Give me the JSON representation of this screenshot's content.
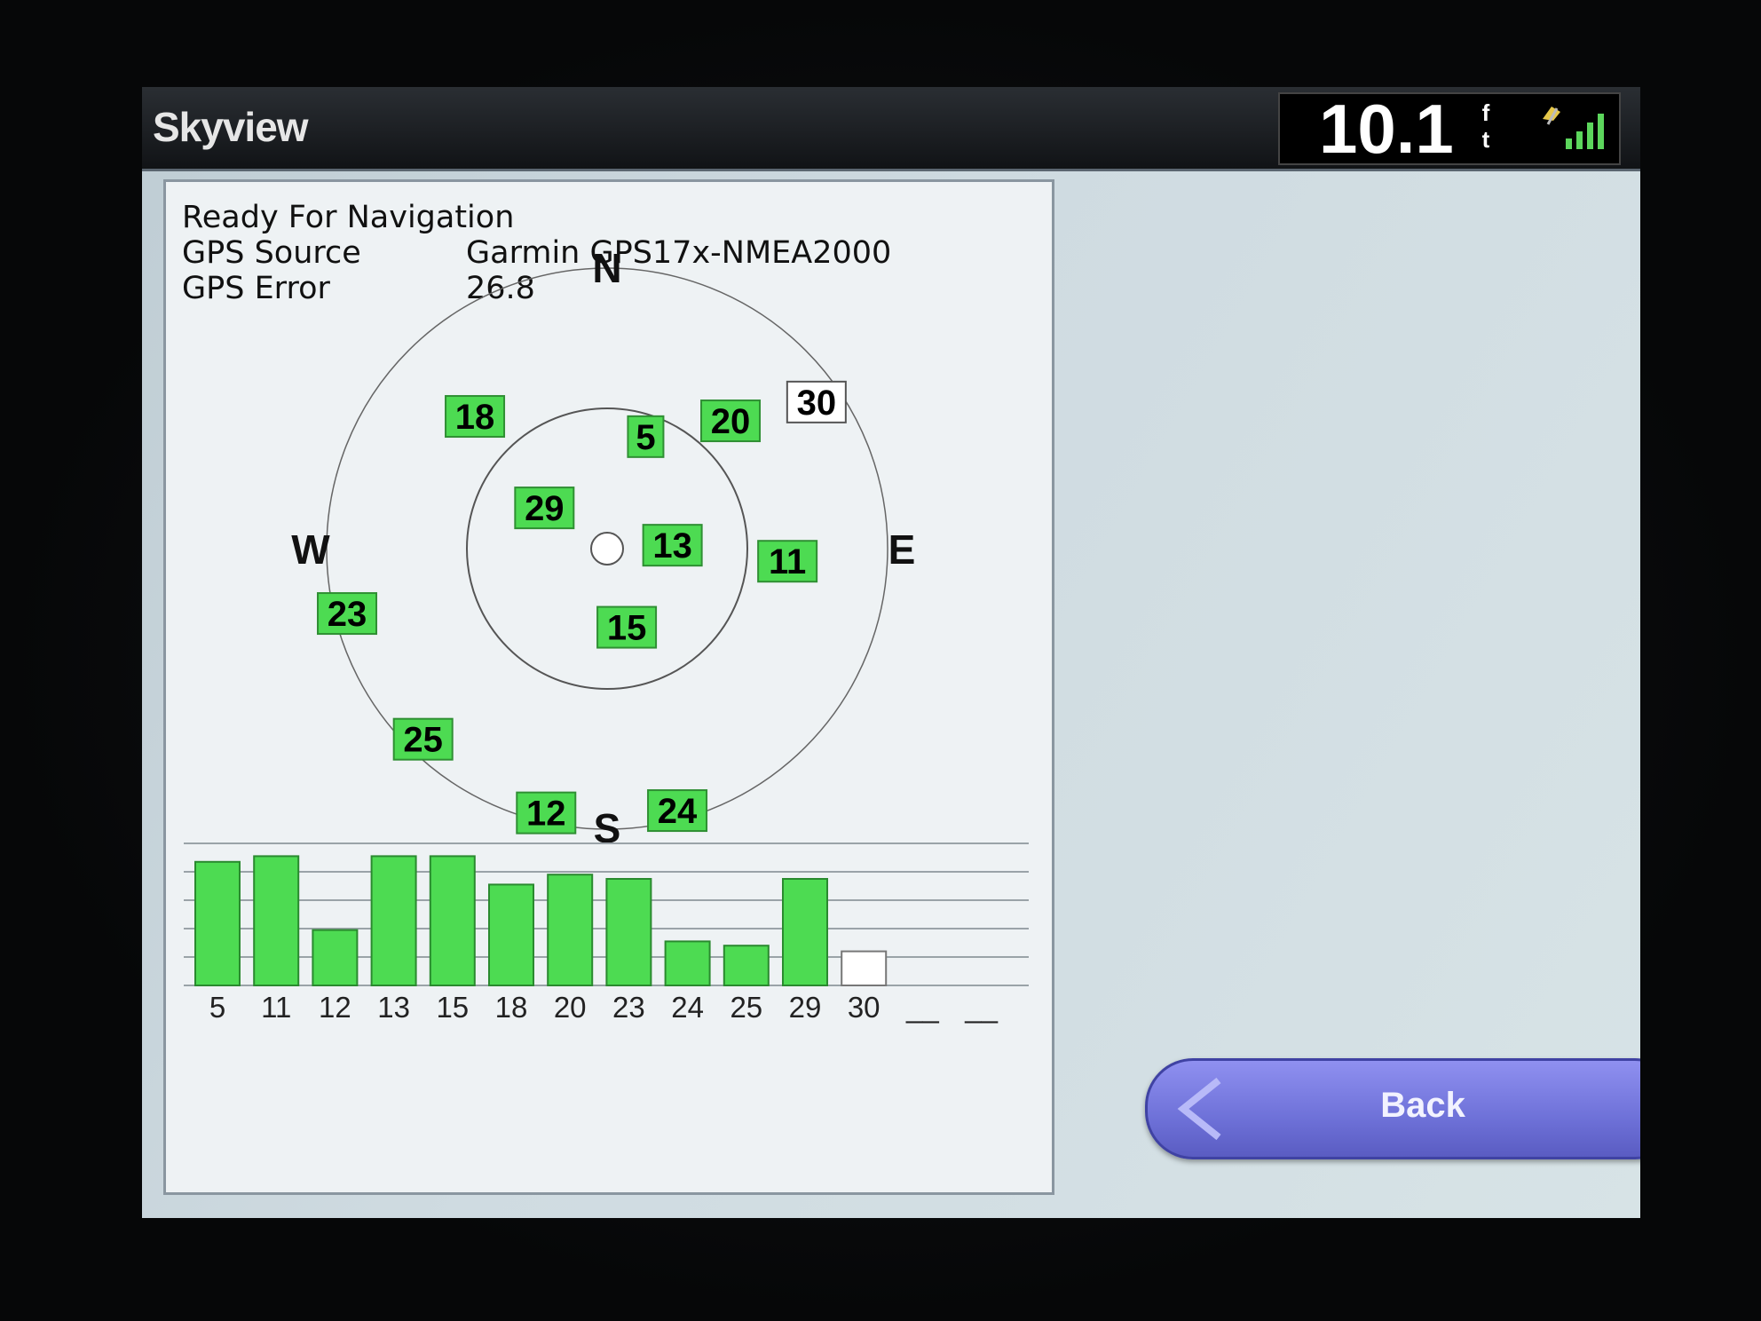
{
  "window": {
    "title": "Skyview"
  },
  "status_bar": {
    "depth_value": "10.1",
    "depth_unit_top": "f",
    "depth_unit_bottom": "t",
    "signal_icon": "gps-signal-strength-icon"
  },
  "info": {
    "status": "Ready For Navigation",
    "gps_source_label": "GPS Source",
    "gps_source_value": "Garmin GPS17x-NMEA2000",
    "gps_error_label": "GPS Error",
    "gps_error_value": "26.8"
  },
  "compass": {
    "north": "N",
    "south": "S",
    "east": "E",
    "west": "W"
  },
  "satellites": [
    {
      "id": "18",
      "azimuth_deg": 315,
      "elevation_deg": 30,
      "tracked": true
    },
    {
      "id": "5",
      "azimuth_deg": 19,
      "elevation_deg": 52,
      "tracked": true
    },
    {
      "id": "20",
      "azimuth_deg": 44,
      "elevation_deg": 33,
      "tracked": true
    },
    {
      "id": "30",
      "azimuth_deg": 55,
      "elevation_deg": 8,
      "tracked": false
    },
    {
      "id": "29",
      "azimuth_deg": 303,
      "elevation_deg": 66,
      "tracked": true
    },
    {
      "id": "13",
      "azimuth_deg": 87,
      "elevation_deg": 69,
      "tracked": true
    },
    {
      "id": "11",
      "azimuth_deg": 94,
      "elevation_deg": 32,
      "tracked": true
    },
    {
      "id": "23",
      "azimuth_deg": 256,
      "elevation_deg": 4,
      "tracked": true
    },
    {
      "id": "15",
      "azimuth_deg": 166,
      "elevation_deg": 64,
      "tracked": true
    },
    {
      "id": "25",
      "azimuth_deg": 224,
      "elevation_deg": 5,
      "tracked": true
    },
    {
      "id": "12",
      "azimuth_deg": 193,
      "elevation_deg": 3,
      "tracked": true
    },
    {
      "id": "24",
      "azimuth_deg": 165,
      "elevation_deg": 3,
      "tracked": true
    }
  ],
  "signal_bars": [
    {
      "id": "5",
      "strength": 0.87,
      "tracked": true
    },
    {
      "id": "11",
      "strength": 0.91,
      "tracked": true
    },
    {
      "id": "12",
      "strength": 0.39,
      "tracked": true
    },
    {
      "id": "13",
      "strength": 0.91,
      "tracked": true
    },
    {
      "id": "15",
      "strength": 0.91,
      "tracked": true
    },
    {
      "id": "18",
      "strength": 0.71,
      "tracked": true
    },
    {
      "id": "20",
      "strength": 0.78,
      "tracked": true
    },
    {
      "id": "23",
      "strength": 0.75,
      "tracked": true
    },
    {
      "id": "24",
      "strength": 0.31,
      "tracked": true
    },
    {
      "id": "25",
      "strength": 0.28,
      "tracked": true
    },
    {
      "id": "29",
      "strength": 0.75,
      "tracked": true
    },
    {
      "id": "30",
      "strength": 0.24,
      "tracked": false
    },
    {
      "id": "__",
      "strength": 0,
      "tracked": false
    },
    {
      "id": "__",
      "strength": 0,
      "tracked": false
    }
  ],
  "back_button": {
    "label": "Back",
    "icon": "chevron-left-icon"
  },
  "colors": {
    "tracked_fill": "#4ddb52",
    "untracked_fill": "#ffffff",
    "button": "#7c7fe4"
  }
}
